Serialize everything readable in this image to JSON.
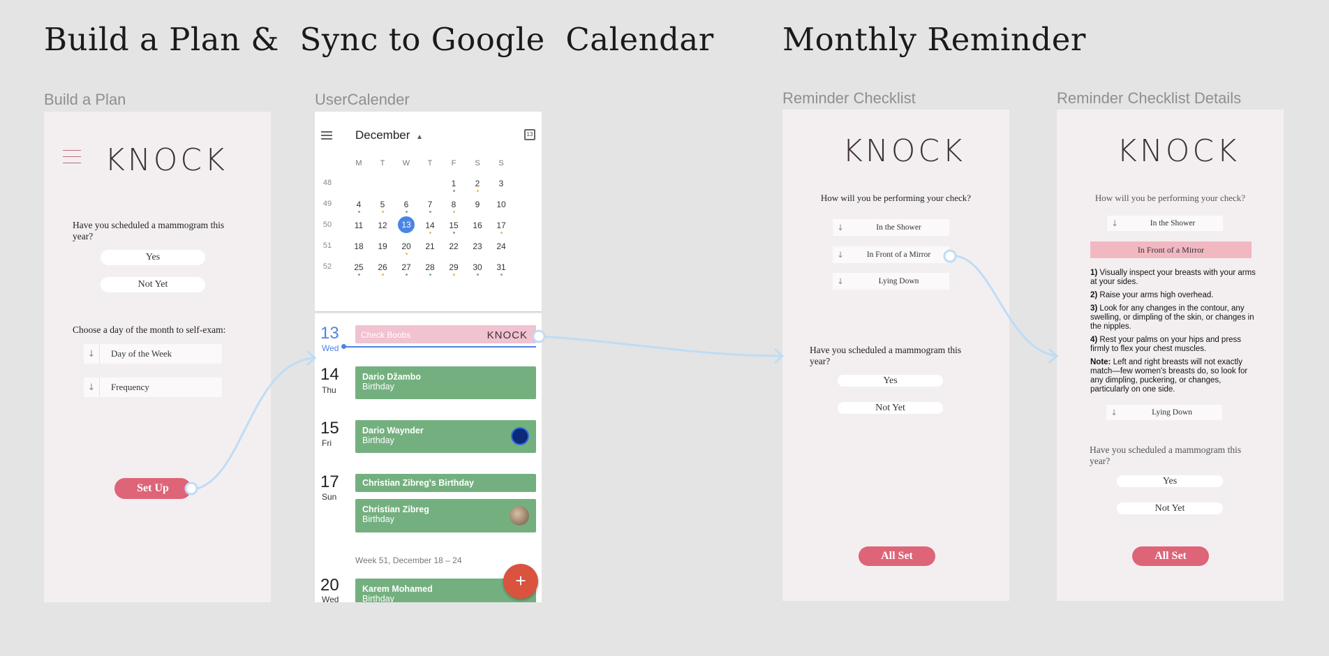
{
  "headings": {
    "left": "Build a Plan &  Sync to Google  Calendar",
    "right": "Monthly Reminder"
  },
  "frames": {
    "build": {
      "label": "Build a Plan",
      "logo": "KNOCK",
      "question1": "Have you scheduled  a mammogram this year?",
      "yes": "Yes",
      "not_yet": "Not Yet",
      "question2": "Choose a day of the month  to self-exam:",
      "field1": "Day of the Week",
      "field2": "Frequency",
      "setup": "Set Up"
    },
    "calendar": {
      "label": "UserCalender",
      "month": "December",
      "weekdays": [
        "M",
        "T",
        "W",
        "T",
        "F",
        "S",
        "S"
      ],
      "weeks": [
        {
          "num": "48",
          "days": [
            "",
            "",
            "",
            "",
            "1",
            "2",
            "3"
          ]
        },
        {
          "num": "49",
          "days": [
            "4",
            "5",
            "6",
            "7",
            "8",
            "9",
            "10"
          ]
        },
        {
          "num": "50",
          "days": [
            "11",
            "12",
            "13",
            "14",
            "15",
            "16",
            "17"
          ]
        },
        {
          "num": "51",
          "days": [
            "18",
            "19",
            "20",
            "21",
            "22",
            "23",
            "24"
          ]
        },
        {
          "num": "52",
          "days": [
            "25",
            "26",
            "27",
            "28",
            "29",
            "30",
            "31"
          ]
        }
      ],
      "agenda": [
        {
          "num": "13",
          "day": "Wed",
          "title": "Check Boobs",
          "tag": "KNOCK"
        },
        {
          "num": "14",
          "day": "Thu",
          "title": "Dario Džambo",
          "sub": "Birthday"
        },
        {
          "num": "15",
          "day": "Fri",
          "title": "Dario Waynder",
          "sub": "Birthday"
        },
        {
          "num": "17",
          "day": "Sun",
          "title": "Christian Zibreg's Birthday",
          "title2": "Christian Zibreg",
          "sub": "Birthday"
        },
        {
          "num": "20",
          "day": "Wed",
          "title": "Karem Mohamed",
          "sub": "Birthday"
        }
      ],
      "week_header": "Week 51, December 18 – 24",
      "fab": "+",
      "colors": {
        "event": "#74b07f",
        "selected": "#4a84e6",
        "pink": "#f1c2d0",
        "fab": "#d9533f"
      }
    },
    "checklist": {
      "label": "Reminder Checklist",
      "logo": "KNOCK",
      "question": "How will you be performing your check?",
      "options": [
        "In the Shower",
        "In Front of a Mirror",
        "Lying Down"
      ],
      "question2": "Have you scheduled  a mammogram this year?",
      "yes": "Yes",
      "not_yet": "Not Yet",
      "all_set": "All  Set"
    },
    "details": {
      "label": "Reminder Checklist Details",
      "logo": "KNOCK",
      "question": "How will you be performing your check?",
      "option1": "In the Shower",
      "option_selected": "In Front of a Mirror",
      "steps": [
        {
          "num": "1)",
          "text": "Visually inspect your breasts with your arms at your sides."
        },
        {
          "num": "2)",
          "text": "Raise your arms high overhead."
        },
        {
          "num": "3)",
          "text": "Look for any changes in the contour, any swelling, or dimpling of the skin, or changes in the nipples."
        },
        {
          "num": "4)",
          "text": "Rest your palms on your hips and press firmly to flex your chest muscles."
        },
        {
          "num": "Note:",
          "text": "Left and right breasts will not exactly match—few women's breasts do, so look for any dimpling, puckering, or changes, particularly on one side."
        }
      ],
      "option3": "Lying Down",
      "question2": "Have you scheduled  a mammogram this year?",
      "yes": "Yes",
      "not_yet": "Not Yet",
      "all_set": "All  Set"
    }
  },
  "colors": {
    "accent": "#de6478",
    "frame": "#f3eff1",
    "connector": "#bfdcf5",
    "background": "#e4e4e4"
  }
}
